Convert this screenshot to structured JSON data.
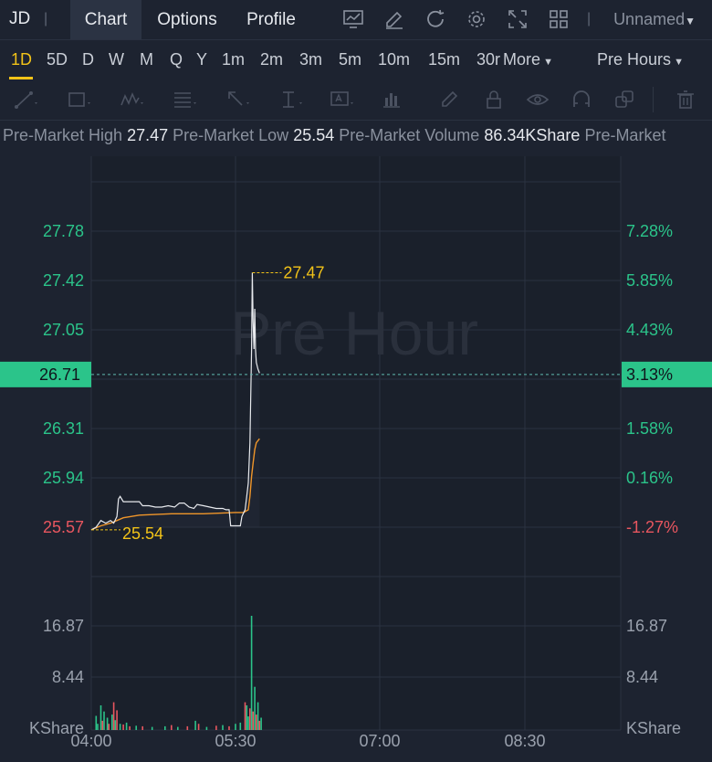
{
  "header": {
    "symbol": "JD",
    "tabs": [
      "Chart",
      "Options",
      "Profile"
    ],
    "active_tab": "Chart",
    "layout_name": "Unnamed"
  },
  "timeframes": {
    "items": [
      "1D",
      "5D",
      "D",
      "W",
      "M",
      "Q",
      "Y",
      "1m",
      "2m",
      "3m",
      "5m",
      "10m",
      "15m",
      "30r"
    ],
    "more": "More",
    "active": "1D",
    "session": "Pre Hours"
  },
  "stats": [
    {
      "label": "Pre-Market High",
      "value": "27.47"
    },
    {
      "label": "Pre-Market Low",
      "value": "25.54"
    },
    {
      "label": "Pre-Market Volume",
      "value": "86.34KShare"
    },
    {
      "label": "Pre-Market",
      "value": ""
    }
  ],
  "watermark": "Pre Hour",
  "chart_data": {
    "type": "line",
    "price_axis": {
      "ticks": [
        27.78,
        27.42,
        27.05,
        26.31,
        25.94,
        25.57
      ],
      "tick_labels": [
        "27.78",
        "27.42",
        "27.05",
        "26.31",
        "25.94",
        "25.57"
      ],
      "current": "26.71"
    },
    "percent_axis": {
      "tick_labels": [
        "7.28%",
        "5.85%",
        "4.43%",
        "1.58%",
        "0.16%",
        "-1.27%"
      ],
      "current": "3.13%"
    },
    "volume_axis": {
      "tick_labels": [
        "16.87",
        "8.44"
      ],
      "unit": "KShare"
    },
    "x_labels": [
      "04:00",
      "05:30",
      "07:00",
      "08:30"
    ],
    "high_marker": "27.47",
    "low_marker": "25.54",
    "colors": {
      "up": "#2bc48a",
      "down": "#e8565f",
      "price_line": "#e8eaee",
      "avg_line": "#f0962a",
      "marker": "#f2c318"
    }
  }
}
